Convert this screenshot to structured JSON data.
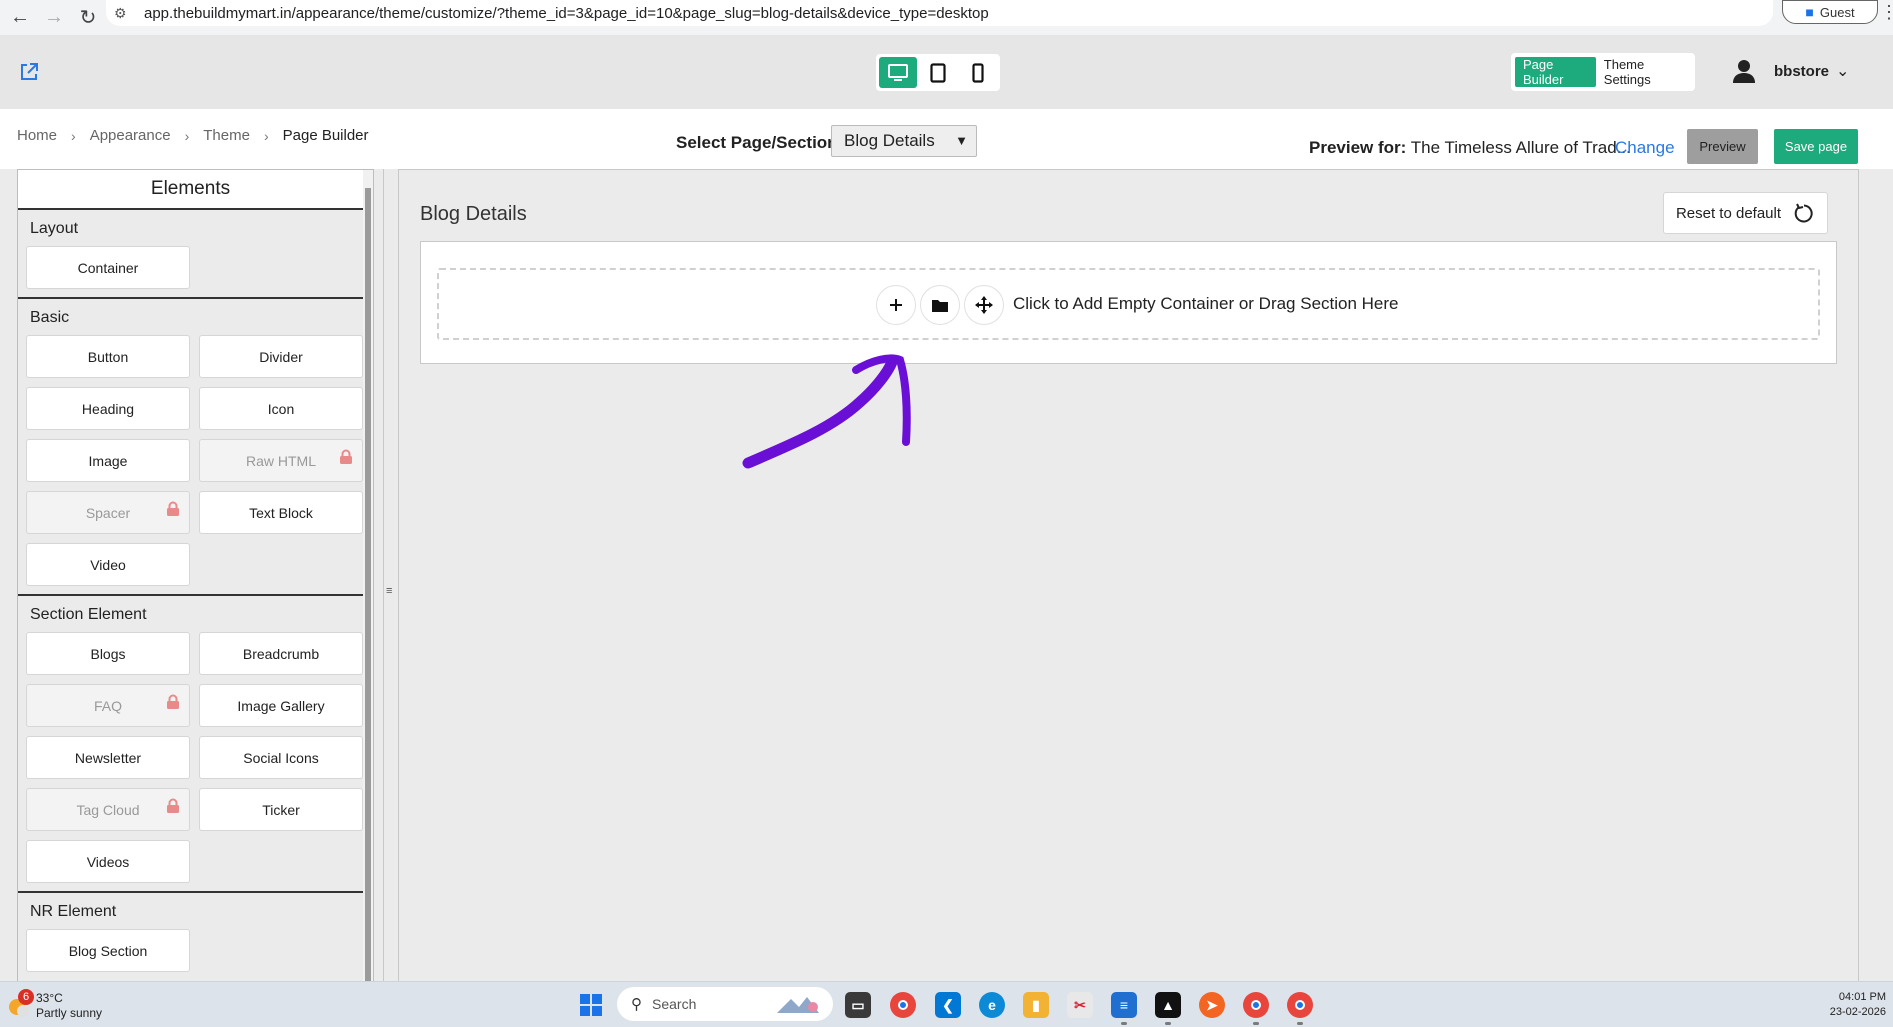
{
  "browser": {
    "url": "app.thebuildmymart.in/appearance/theme/customize/?theme_id=3&page_id=10&page_slug=blog-details&device_type=desktop",
    "profile_label": "Guest"
  },
  "header": {
    "device_modes": [
      "desktop",
      "tablet",
      "mobile"
    ],
    "active_device": "desktop",
    "mode_tabs": [
      "Page Builder",
      "Theme Settings"
    ],
    "active_mode": "Page Builder",
    "user_name": "bbstore",
    "accent_color": "#1daa7c"
  },
  "toolbar": {
    "breadcrumb": [
      "Home",
      "Appearance",
      "Theme",
      "Page Builder"
    ],
    "select_label": "Select Page/Section:",
    "selected_page": "Blog Details",
    "preview_for_label": "Preview for:",
    "preview_for_value": "The Timeless Allure of Trad...",
    "change_label": "Change",
    "preview_button": "Preview",
    "save_button": "Save page"
  },
  "elements_panel": {
    "title": "Elements",
    "sections": [
      {
        "title": "Layout",
        "items": [
          {
            "label": "Container",
            "locked": false
          }
        ]
      },
      {
        "title": "Basic",
        "items": [
          {
            "label": "Button",
            "locked": false
          },
          {
            "label": "Divider",
            "locked": false
          },
          {
            "label": "Heading",
            "locked": false
          },
          {
            "label": "Icon",
            "locked": false
          },
          {
            "label": "Image",
            "locked": false
          },
          {
            "label": "Raw HTML",
            "locked": true
          },
          {
            "label": "Spacer",
            "locked": true
          },
          {
            "label": "Text Block",
            "locked": false
          },
          {
            "label": "Video",
            "locked": false
          }
        ]
      },
      {
        "title": "Section Element",
        "items": [
          {
            "label": "Blogs",
            "locked": false
          },
          {
            "label": "Breadcrumb",
            "locked": false
          },
          {
            "label": "FAQ",
            "locked": true
          },
          {
            "label": "Image Gallery",
            "locked": false
          },
          {
            "label": "Newsletter",
            "locked": false
          },
          {
            "label": "Social Icons",
            "locked": false
          },
          {
            "label": "Tag Cloud",
            "locked": true
          },
          {
            "label": "Ticker",
            "locked": false
          },
          {
            "label": "Videos",
            "locked": false
          }
        ]
      },
      {
        "title": "NR Element",
        "items": [
          {
            "label": "Blog Section",
            "locked": false
          }
        ]
      }
    ]
  },
  "canvas": {
    "title": "Blog Details",
    "reset_button": "Reset to default",
    "dropzone_text": "Click to Add Empty Container or Drag Section Here",
    "dropzone_icons": [
      "plus-icon",
      "folder-icon",
      "move-icon"
    ],
    "annotation_color": "#6a0fd6"
  },
  "taskbar": {
    "weather_temp": "33°C",
    "weather_desc": "Partly sunny",
    "weather_badge": "6",
    "search_placeholder": "Search",
    "time": "04:01 PM",
    "date": "23-02-2026"
  }
}
